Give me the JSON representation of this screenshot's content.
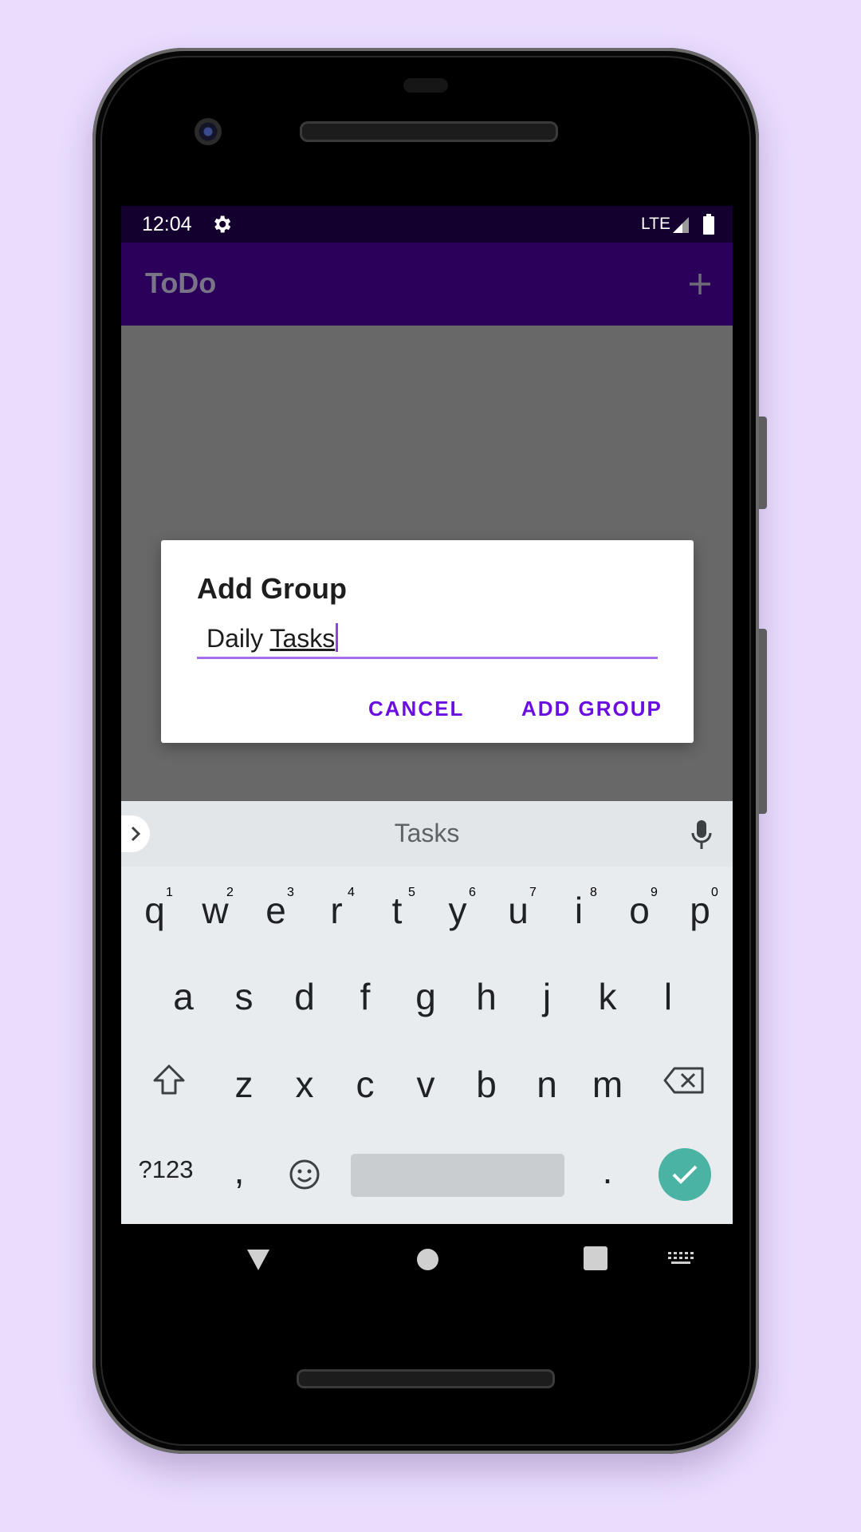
{
  "status_bar": {
    "time": "12:04",
    "network": "LTE",
    "icons": [
      "gear-icon",
      "signal-icon",
      "battery-icon"
    ]
  },
  "app_bar": {
    "title": "ToDo",
    "action_icon": "plus-icon"
  },
  "dialog": {
    "title": "Add Group",
    "input_prefix": "Daily ",
    "input_composing": "Tasks",
    "cancel_label": "CANCEL",
    "confirm_label": "ADD GROUP"
  },
  "keyboard": {
    "suggestion": "Tasks",
    "row1": [
      "q",
      "w",
      "e",
      "r",
      "t",
      "y",
      "u",
      "i",
      "o",
      "p"
    ],
    "row1_hints": [
      "1",
      "2",
      "3",
      "4",
      "5",
      "6",
      "7",
      "8",
      "9",
      "0"
    ],
    "row2": [
      "a",
      "s",
      "d",
      "f",
      "g",
      "h",
      "j",
      "k",
      "l"
    ],
    "row3": [
      "z",
      "x",
      "c",
      "v",
      "b",
      "n",
      "m"
    ],
    "symbols_label": "?123",
    "comma": ",",
    "period": "."
  },
  "nav_bar": {
    "icons": [
      "back-icon",
      "home-icon",
      "recents-icon",
      "keyboard-switch-icon"
    ]
  },
  "colors": {
    "page_background": "#e9dcfd",
    "app_bar": "#2a005a",
    "status_bar": "#14002e",
    "accent": "#6b0fe0",
    "enter_key": "#4bb3a4"
  }
}
